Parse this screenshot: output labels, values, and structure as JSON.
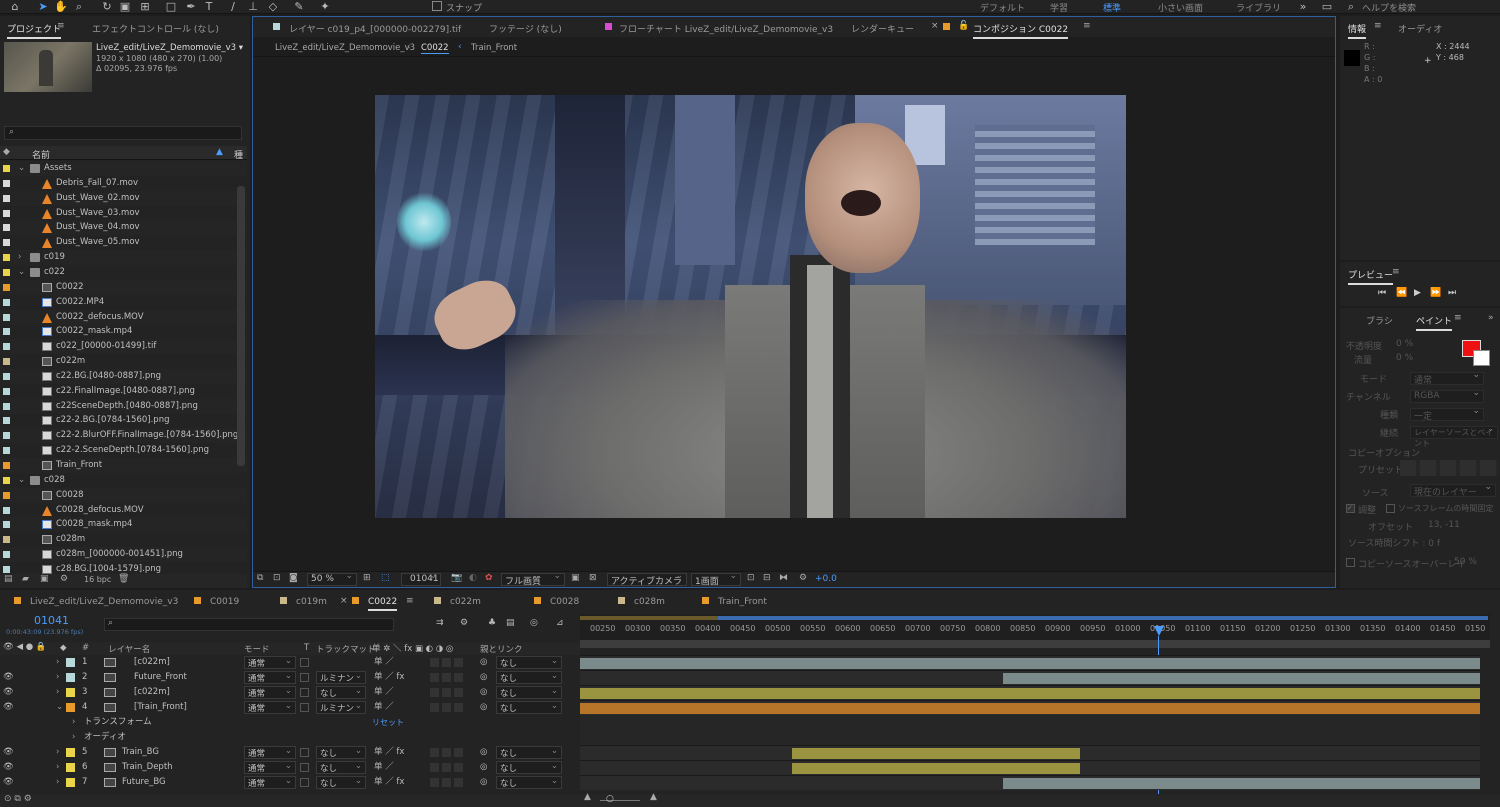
{
  "toolbar": {
    "snap_label": "スナップ",
    "workspaces": [
      "デフォルト",
      "学習",
      "標準",
      "小さい画面",
      "ライブラリ"
    ],
    "help_placeholder": "ヘルプを検索"
  },
  "project_panel": {
    "tab_project": "プロジェクト",
    "tab_effects": "エフェクトコントロール (なし)",
    "item_name": "LiveZ_edit/LiveZ_Demomovie_v3 ▾",
    "item_res": "1920 x 1080  (480 x 270) (1.00)",
    "item_dur": "Δ 02095, 23.976 fps",
    "col_name": "名前",
    "col_type": "種",
    "footer_bpc": "16 bpc",
    "items": [
      {
        "label": "Assets",
        "type": "folder",
        "indent": 0,
        "color": "#e8d54a",
        "open": true
      },
      {
        "label": "Debris_Fall_07.mov",
        "type": "cone",
        "indent": 1,
        "color": "#d9d9d9"
      },
      {
        "label": "Dust_Wave_02.mov",
        "type": "cone",
        "indent": 1,
        "color": "#d9d9d9"
      },
      {
        "label": "Dust_Wave_03.mov",
        "type": "cone",
        "indent": 1,
        "color": "#d9d9d9"
      },
      {
        "label": "Dust_Wave_04.mov",
        "type": "cone",
        "indent": 1,
        "color": "#d9d9d9"
      },
      {
        "label": "Dust_Wave_05.mov",
        "type": "cone",
        "indent": 1,
        "color": "#d9d9d9"
      },
      {
        "label": "c019",
        "type": "folder",
        "indent": 0,
        "color": "#e8d54a",
        "open": false
      },
      {
        "label": "c022",
        "type": "folder",
        "indent": 0,
        "color": "#e8d54a",
        "open": true
      },
      {
        "label": "C0022",
        "type": "comp",
        "indent": 1,
        "color": "#e89a2a"
      },
      {
        "label": "C0022.MP4",
        "type": "mp4",
        "indent": 1,
        "color": "#b7d8d8"
      },
      {
        "label": "C0022_defocus.MOV",
        "type": "cone",
        "indent": 1,
        "color": "#b7d8d8"
      },
      {
        "label": "C0022_mask.mp4",
        "type": "mp4",
        "indent": 1,
        "color": "#b7d8d8"
      },
      {
        "label": "c022_[00000-01499].tif",
        "type": "img",
        "indent": 1,
        "color": "#b7d8d8"
      },
      {
        "label": "c022m",
        "type": "comp",
        "indent": 1,
        "color": "#c9b88a"
      },
      {
        "label": "c22.BG.[0480-0887].png",
        "type": "img",
        "indent": 1,
        "color": "#b7d8d8"
      },
      {
        "label": "c22.FinalImage.[0480-0887].png",
        "type": "img",
        "indent": 1,
        "color": "#b7d8d8"
      },
      {
        "label": "c22SceneDepth.[0480-0887].png",
        "type": "img",
        "indent": 1,
        "color": "#b7d8d8"
      },
      {
        "label": "c22-2.BG.[0784-1560].png",
        "type": "img",
        "indent": 1,
        "color": "#b7d8d8"
      },
      {
        "label": "c22-2.BlurOFF.FinalImage.[0784-1560].png",
        "type": "img",
        "indent": 1,
        "color": "#b7d8d8"
      },
      {
        "label": "c22-2.SceneDepth.[0784-1560].png",
        "type": "img",
        "indent": 1,
        "color": "#b7d8d8"
      },
      {
        "label": "Train_Front",
        "type": "comp",
        "indent": 1,
        "color": "#e89a2a"
      },
      {
        "label": "c028",
        "type": "folder",
        "indent": 0,
        "color": "#e8d54a",
        "open": true
      },
      {
        "label": "C0028",
        "type": "comp",
        "indent": 1,
        "color": "#e89a2a"
      },
      {
        "label": "C0028_defocus.MOV",
        "type": "cone",
        "indent": 1,
        "color": "#b7d8d8"
      },
      {
        "label": "C0028_mask.mp4",
        "type": "mp4",
        "indent": 1,
        "color": "#b7d8d8"
      },
      {
        "label": "c028m",
        "type": "comp",
        "indent": 1,
        "color": "#c9b88a"
      },
      {
        "label": "c028m_[000000-001451].png",
        "type": "img",
        "indent": 1,
        "color": "#b7d8d8"
      },
      {
        "label": "c28.BG.[1004-1579].png",
        "type": "img",
        "indent": 1,
        "color": "#b7d8d8"
      }
    ]
  },
  "viewer": {
    "tabs": [
      "レイヤー c019_p4_[000000-002279].tif",
      "フッテージ (なし)",
      "フローチャート LiveZ_edit/LiveZ_Demomovie_v3",
      "レンダーキュー",
      "コンポジション C0022"
    ],
    "active_tab": "コンポジション C0022",
    "breadcrumbs": [
      "LiveZ_edit/LiveZ_Demomovie_v3",
      "C0022",
      "Train_Front"
    ],
    "zoom": "50 %",
    "timecode": "01041",
    "resolution": "フル画質",
    "camera": "アクティブカメラ",
    "views": "1画面",
    "exposure": "+0.0"
  },
  "info_panel": {
    "tab_info": "情報",
    "tab_audio": "オーディオ",
    "r": "R :",
    "g": "G :",
    "b": "B :",
    "a": "A :  0",
    "x": "X : 2444",
    "y": "Y : 468"
  },
  "preview_panel": {
    "title": "プレビュー"
  },
  "paint_panel": {
    "tab_brush": "ブラシ",
    "tab_paint": "ペイント",
    "opacity": "不透明度",
    "flow": "流量",
    "opacity_val": "0 %",
    "flow_val": "0 %",
    "mode_label": "モード",
    "mode_val": "通常",
    "channel_label": "チャンネル",
    "channel_val": "RGBA",
    "method_label": "種類",
    "method_val": "一定",
    "duration_label": "継続",
    "duration_val": "レイヤーソースとペイント",
    "clone_title": "コピーオプション",
    "preset_label": "プリセット",
    "source_label": "ソース",
    "source_val": "現在のレイヤー",
    "aligned": "調整",
    "lock_time": "ソースフレームの時間固定",
    "offset_label": "オフセット",
    "offset_val": "13,   -11",
    "src_time": "ソース時間シフト : 0 f",
    "overlay": "コピーソースオーバーレイ",
    "overlay_val": "50 %"
  },
  "timeline": {
    "tabs": [
      {
        "label": "LiveZ_edit/LiveZ_Demomovie_v3",
        "color": "#e89a2a"
      },
      {
        "label": "C0019",
        "color": "#e89a2a"
      },
      {
        "label": "c019m",
        "color": "#c9b88a"
      },
      {
        "label": "C0022",
        "color": "#e89a2a",
        "active": true
      },
      {
        "label": "c022m",
        "color": "#c9b88a"
      },
      {
        "label": "C0028",
        "color": "#e89a2a"
      },
      {
        "label": "c028m",
        "color": "#c9b88a"
      },
      {
        "label": "Train_Front",
        "color": "#e89a2a"
      }
    ],
    "timecode": "01041",
    "timecode_sub": "0:00:43:09 (23.976 fps)",
    "col_hash": "#",
    "col_layer": "レイヤー名",
    "col_mode": "モード",
    "col_t": "T",
    "col_matte": "トラックマット",
    "col_parent": "親とリンク",
    "ruler": [
      "00250",
      "00300",
      "00350",
      "00400",
      "00450",
      "00500",
      "00550",
      "00600",
      "00650",
      "00700",
      "00750",
      "00800",
      "00850",
      "00900",
      "00950",
      "01000",
      "01050",
      "01100",
      "01150",
      "01200",
      "01250",
      "01300",
      "01350",
      "01400",
      "01450",
      "0150"
    ],
    "layers": [
      {
        "num": "1",
        "name": "[c022m]",
        "color": "#b7d8d8",
        "mode": "通常",
        "matte": "",
        "parent": "なし",
        "bar_start": 0.0,
        "bar_end": 1.0,
        "bar_color": "#7b8b8b"
      },
      {
        "num": "2",
        "name": "Future_Front",
        "color": "#b7d8d8",
        "mode": "通常",
        "matte": "ルミナン",
        "parent": "なし",
        "bar_start": 0.47,
        "bar_end": 1.0,
        "bar_color": "#7b8b8b"
      },
      {
        "num": "3",
        "name": "[c022m]",
        "color": "#e8d54a",
        "mode": "通常",
        "matte": "なし",
        "parent": "なし",
        "bar_start": 0.0,
        "bar_end": 1.0,
        "bar_color": "#9a9440"
      },
      {
        "num": "4",
        "name": "[Train_Front]",
        "color": "#e89a2a",
        "mode": "通常",
        "matte": "ルミナン",
        "parent": "なし",
        "bar_start": 0.0,
        "bar_end": 1.0,
        "bar_color": "#b7752a"
      },
      {
        "num": "5",
        "name": "Train_BG",
        "color": "#e8d54a",
        "mode": "通常",
        "matte": "なし",
        "parent": "なし",
        "bar_start": 0.235,
        "bar_end": 0.555,
        "bar_color": "#9a9440"
      },
      {
        "num": "6",
        "name": "Train_Depth",
        "color": "#e8d54a",
        "mode": "通常",
        "matte": "なし",
        "parent": "なし",
        "bar_start": 0.235,
        "bar_end": 0.555,
        "bar_color": "#9a9440"
      },
      {
        "num": "7",
        "name": "Future_BG",
        "color": "#e8d54a",
        "mode": "通常",
        "matte": "なし",
        "parent": "なし",
        "bar_start": 0.47,
        "bar_end": 1.0,
        "bar_color": "#7b8b8b"
      }
    ],
    "sub_transform": "トランスフォーム",
    "sub_reset": "リセット",
    "sub_audio": "オーディオ"
  }
}
